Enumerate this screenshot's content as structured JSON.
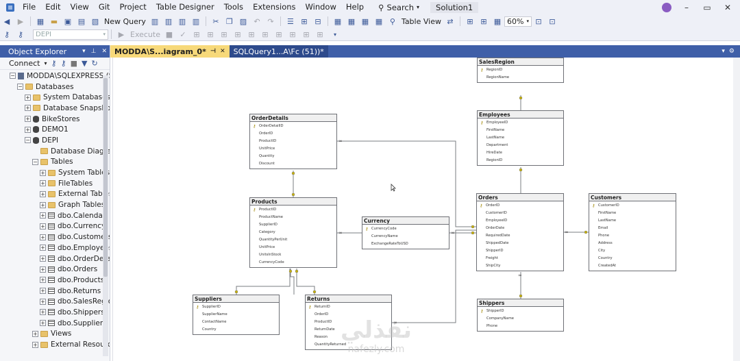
{
  "menu": {
    "items": [
      "File",
      "Edit",
      "View",
      "Git",
      "Project",
      "Table Designer",
      "Tools",
      "Extensions",
      "Window",
      "Help"
    ],
    "search_label": "Search",
    "solution": "Solution1"
  },
  "toolbar": {
    "new_query": "New Query",
    "database_combo": "DEPI",
    "execute": "Execute",
    "table_view": "Table View",
    "zoom": "60%"
  },
  "object_explorer": {
    "title": "Object Explorer",
    "connect": "Connect",
    "tree": [
      {
        "label": "MODDA\\SQLEXPRESS (SQ",
        "level": 0,
        "exp": "−",
        "icon": "server-icon"
      },
      {
        "label": "Databases",
        "level": 1,
        "exp": "−",
        "icon": "folder-icon"
      },
      {
        "label": "System Databases",
        "level": 2,
        "exp": "+",
        "icon": "folder-icon"
      },
      {
        "label": "Database Snapshots",
        "level": 2,
        "exp": "+",
        "icon": "folder-icon"
      },
      {
        "label": "BikeStores",
        "level": 2,
        "exp": "+",
        "icon": "database-icon"
      },
      {
        "label": "DEMO1",
        "level": 2,
        "exp": "+",
        "icon": "database-icon"
      },
      {
        "label": "DEPI",
        "level": 2,
        "exp": "−",
        "icon": "database-icon"
      },
      {
        "label": "Database Diagram",
        "level": 3,
        "exp": "",
        "icon": "folder-icon"
      },
      {
        "label": "Tables",
        "level": 3,
        "exp": "−",
        "icon": "folder-icon"
      },
      {
        "label": "System Tables",
        "level": 4,
        "exp": "+",
        "icon": "folder-icon"
      },
      {
        "label": "FileTables",
        "level": 4,
        "exp": "+",
        "icon": "folder-icon"
      },
      {
        "label": "External Tables",
        "level": 4,
        "exp": "+",
        "icon": "folder-icon"
      },
      {
        "label": "Graph Tables",
        "level": 4,
        "exp": "+",
        "icon": "folder-icon"
      },
      {
        "label": "dbo.Calendar",
        "level": 4,
        "exp": "+",
        "icon": "table-icon"
      },
      {
        "label": "dbo.Currency",
        "level": 4,
        "exp": "+",
        "icon": "table-icon"
      },
      {
        "label": "dbo.Customers",
        "level": 4,
        "exp": "+",
        "icon": "table-icon"
      },
      {
        "label": "dbo.Employees",
        "level": 4,
        "exp": "+",
        "icon": "table-icon"
      },
      {
        "label": "dbo.OrderDetai",
        "level": 4,
        "exp": "+",
        "icon": "table-icon"
      },
      {
        "label": "dbo.Orders",
        "level": 4,
        "exp": "+",
        "icon": "table-icon"
      },
      {
        "label": "dbo.Products",
        "level": 4,
        "exp": "+",
        "icon": "table-icon"
      },
      {
        "label": "dbo.Returns",
        "level": 4,
        "exp": "+",
        "icon": "table-icon"
      },
      {
        "label": "dbo.SalesRegio",
        "level": 4,
        "exp": "+",
        "icon": "table-icon"
      },
      {
        "label": "dbo.Shippers",
        "level": 4,
        "exp": "+",
        "icon": "table-icon"
      },
      {
        "label": "dbo.Suppliers",
        "level": 4,
        "exp": "+",
        "icon": "table-icon"
      },
      {
        "label": "Views",
        "level": 3,
        "exp": "+",
        "icon": "folder-icon"
      },
      {
        "label": "External Resources",
        "level": 3,
        "exp": "+",
        "icon": "folder-icon"
      }
    ]
  },
  "tabs": [
    {
      "label": "MODDA\\S...iagram_0*",
      "active": true
    },
    {
      "label": "SQLQuery1...A\\Fc (51))*",
      "active": false
    }
  ],
  "diagram": {
    "tables": [
      {
        "id": "salesregion",
        "title": "SalesRegion",
        "columns": [
          "RegionID",
          "RegionName"
        ],
        "pk": [
          0
        ]
      },
      {
        "id": "employees",
        "title": "Employees",
        "columns": [
          "EmployeeID",
          "FirstName",
          "LastName",
          "Department",
          "HireDate",
          "RegionID"
        ],
        "pk": [
          0
        ]
      },
      {
        "id": "orderdetails",
        "title": "OrderDetails",
        "columns": [
          "OrderDetailID",
          "OrderID",
          "ProductID",
          "UnitPrice",
          "Quantity",
          "Discount"
        ],
        "pk": [
          0
        ]
      },
      {
        "id": "products",
        "title": "Products",
        "columns": [
          "ProductID",
          "ProductName",
          "SupplierID",
          "Category",
          "QuantityPerUnit",
          "UnitPrice",
          "UnitsInStock",
          "CurrencyCode"
        ],
        "pk": [
          0
        ]
      },
      {
        "id": "currency",
        "title": "Currency",
        "columns": [
          "CurrencyCode",
          "CurrencyName",
          "ExchangeRateToUSD"
        ],
        "pk": [
          0
        ]
      },
      {
        "id": "orders",
        "title": "Orders",
        "columns": [
          "OrderID",
          "CustomerID",
          "EmployeeID",
          "OrderDate",
          "RequiredDate",
          "ShippedDate",
          "ShipperID",
          "Freight",
          "ShipCity"
        ],
        "pk": [
          0
        ]
      },
      {
        "id": "customers",
        "title": "Customers",
        "columns": [
          "CustomerID",
          "FirstName",
          "LastName",
          "Email",
          "Phone",
          "Address",
          "City",
          "Country",
          "CreatedAt"
        ],
        "pk": [
          0
        ]
      },
      {
        "id": "suppliers",
        "title": "Suppliers",
        "columns": [
          "SupplierID",
          "SupplierName",
          "ContactName",
          "Country"
        ],
        "pk": [
          0
        ]
      },
      {
        "id": "returns",
        "title": "Returns",
        "columns": [
          "ReturnID",
          "OrderID",
          "ProductID",
          "ReturnDate",
          "Reason",
          "QuantityReturned"
        ],
        "pk": [
          0
        ]
      },
      {
        "id": "shippers",
        "title": "Shippers",
        "columns": [
          "ShipperID",
          "CompanyName",
          "Phone"
        ],
        "pk": [
          0
        ]
      }
    ]
  },
  "watermark": {
    "arabic": "نفذلي",
    "latin": "nafezly.com"
  },
  "colors": {
    "accent": "#3f5fa8",
    "active_tab": "#f7d97a"
  }
}
